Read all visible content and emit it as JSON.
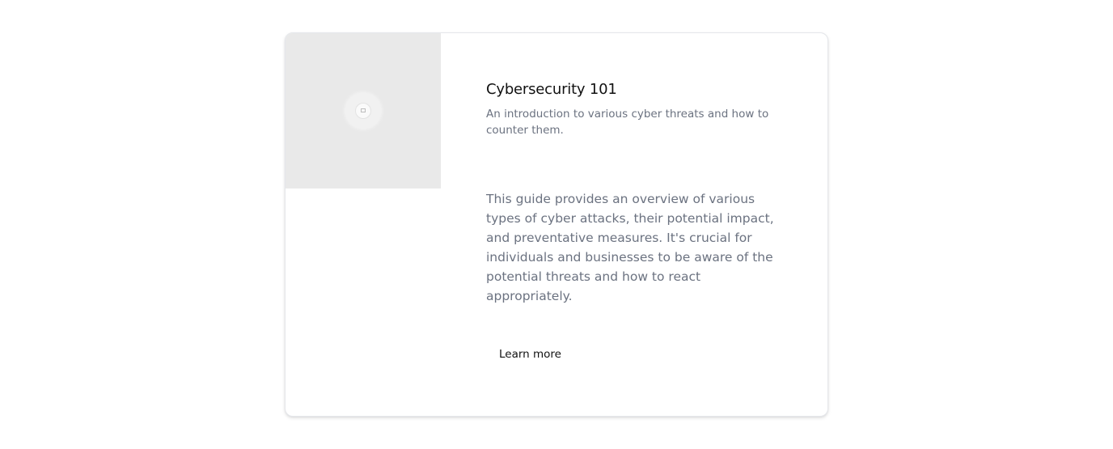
{
  "card": {
    "image": {
      "icon": "image-placeholder-icon",
      "background_color": "#e9e9e9"
    },
    "title": "Cybersecurity 101",
    "subtitle": "An introduction to various cyber threats and how to counter them.",
    "body": "This guide provides an overview of various types of cyber attacks, their potential impact, and preventative measures. It's crucial for individuals and businesses to be aware of the potential threats and how to react appropriately.",
    "action_label": "Learn more"
  },
  "colors": {
    "title": "#111111",
    "muted_text": "#6b7280",
    "card_border": "#e5e7eb"
  }
}
